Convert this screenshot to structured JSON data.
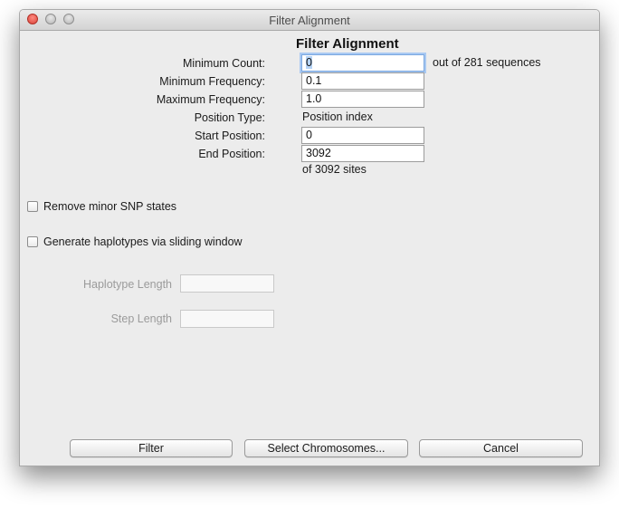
{
  "window": {
    "title": "Filter Alignment"
  },
  "heading": "Filter Alignment",
  "form": {
    "min_count": {
      "label": "Minimum Count:",
      "value": "0",
      "suffix": "out of 281 sequences"
    },
    "min_freq": {
      "label": "Minimum Frequency:",
      "value": "0.1"
    },
    "max_freq": {
      "label": "Maximum Frequency:",
      "value": "1.0"
    },
    "position_type": {
      "label": "Position Type:",
      "value": "Position index"
    },
    "start_pos": {
      "label": "Start Position:",
      "value": "0"
    },
    "end_pos": {
      "label": "End Position:",
      "value": "3092",
      "suffix": "of 3092 sites"
    }
  },
  "options": {
    "remove_minor": {
      "label": "Remove minor SNP states",
      "checked": false
    },
    "sliding_window": {
      "label": "Generate haplotypes via sliding window",
      "checked": false
    },
    "haplotype_length": {
      "label": "Haplotype Length",
      "value": ""
    },
    "step_length": {
      "label": "Step Length",
      "value": ""
    }
  },
  "buttons": {
    "filter": "Filter",
    "select_chromosomes": "Select Chromosomes...",
    "cancel": "Cancel"
  },
  "colors": {
    "close": "#d9443a",
    "focus_ring": "#a9c9f2",
    "selection": "#b5d3f6",
    "disabled_text": "#9b9b9b"
  }
}
